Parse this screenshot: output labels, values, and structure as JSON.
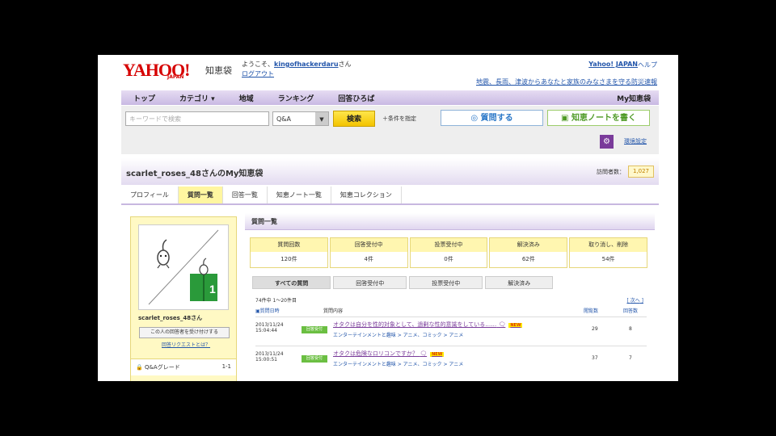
{
  "header": {
    "logo": "YAHOO!",
    "logo_sub": "JAPAN",
    "service": "知恵袋",
    "welcome_prefix": "ようこそ、",
    "username": "kingofhackerdaru",
    "welcome_suffix": "さん",
    "logout": "ログアウト",
    "yahoo_japan": "Yahoo! JAPAN",
    "help": "ヘルプ",
    "promo": "地震、長雨、津波からあなたと家族のみなさまを守る防災速報"
  },
  "nav": {
    "items": [
      "トップ",
      "カテゴリ ▾",
      "地域",
      "ランキング",
      "回答ひろば"
    ],
    "my": "My知恵袋"
  },
  "search": {
    "placeholder": "キーワードで検索",
    "select_value": "Q&A",
    "button": "検索",
    "condition": "＋条件を指定",
    "ask": "質問する",
    "note": "知恵ノートを書く",
    "settings": "環境設定"
  },
  "profile": {
    "title": "scarlet_roses_48さんのMy知恵袋",
    "visits_label": "訪問者数：",
    "visits_value": "1,027",
    "tabs": [
      "プロフィール",
      "質問一覧",
      "回答一覧",
      "知恵ノート一覧",
      "知恵コレクション"
    ],
    "active_tab": 1
  },
  "sidebar": {
    "name": "scarlet_roses_48さん",
    "follow_button": "この人の回答者を受け付けする",
    "what_is": "回答リクエストとは？",
    "grade_label": "Q&Aグレード",
    "grade_value": "1-1"
  },
  "questions": {
    "section_title": "質問一覧",
    "stats": [
      {
        "label": "質問回数",
        "value": "120件"
      },
      {
        "label": "回答受付中",
        "value": "4件"
      },
      {
        "label": "投票受付中",
        "value": "0件"
      },
      {
        "label": "解決済み",
        "value": "62件"
      },
      {
        "label": "取り消し、削除",
        "value": "54件"
      }
    ],
    "subtabs": [
      "すべての質問",
      "回答受付中",
      "投票受付中",
      "解決済み"
    ],
    "range": "74件中 1〜20件目",
    "next": "次へ",
    "columns": {
      "date": "質問日時",
      "content": "質問内容",
      "answers": "閲覧数",
      "replies": "回答数"
    },
    "rows": [
      {
        "date": "2013/11/24 15:04:44",
        "badge": "回答受付",
        "title": "オタクは自分を性的対象として、過剰な性的意識をしている……",
        "category": "エンターテインメントと趣味 > アニメ、コミック > アニメ",
        "new": "NEW",
        "views": "29",
        "answers": "8"
      },
      {
        "date": "2013/11/24 15:00:51",
        "badge": "回答受付",
        "title": "オタクは危険なロリコンですか？",
        "category": "エンターテインメントと趣味 > アニメ、コミック > アニメ",
        "new": "NEW",
        "views": "37",
        "answers": "7"
      }
    ]
  }
}
